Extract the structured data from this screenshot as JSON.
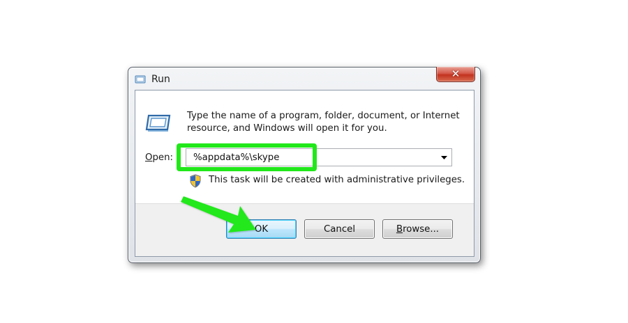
{
  "window": {
    "title": "Run",
    "close_label": "✕"
  },
  "dialog": {
    "description": "Type the name of a program, folder, document, or Internet resource, and Windows will open it for you.",
    "open_label_hotkey": "O",
    "open_label_rest": "pen:",
    "open_value": "%appdata%\\skype",
    "admin_note": "This task will be created with administrative privileges."
  },
  "buttons": {
    "ok": "OK",
    "cancel": "Cancel",
    "browse_hotkey": "B",
    "browse_rest": "rowse..."
  },
  "annotation": {
    "highlight_color": "#22e81b",
    "arrow_color": "#22e81b"
  },
  "icons": [
    "run-icon",
    "close-icon",
    "dropdown-arrow-icon",
    "shield-icon"
  ]
}
